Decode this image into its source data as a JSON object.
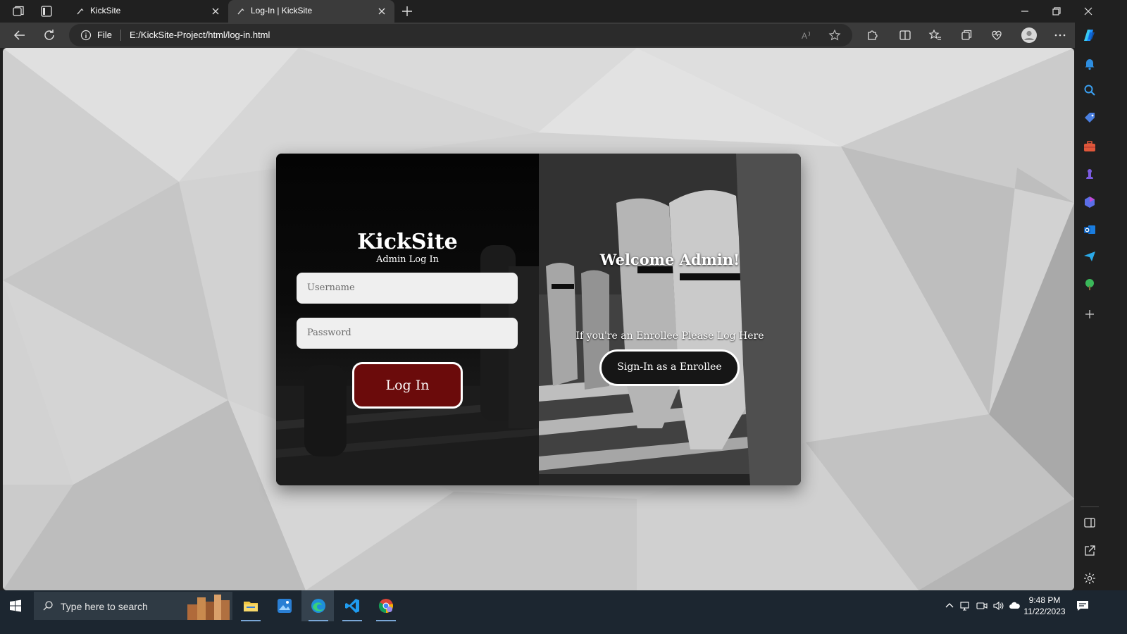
{
  "browser": {
    "tabs": [
      {
        "title": "KickSite",
        "active": false
      },
      {
        "title": "Log-In | KickSite",
        "active": true
      }
    ],
    "address": {
      "scheme": "File",
      "url": "E:/KickSite-Project/html/log-in.html"
    }
  },
  "page": {
    "login_panel": {
      "brand": "KickSite",
      "subtitle": "Admin Log In",
      "username_placeholder": "Username",
      "password_placeholder": "Password",
      "login_button": "Log In"
    },
    "enroll_panel": {
      "welcome": "Welcome Admin!",
      "prompt": "If you're an Enrollee Please Log Here",
      "signin_button": "Sign-In as a Enrollee"
    }
  },
  "taskbar": {
    "search_placeholder": "Type here to search",
    "time": "9:48 PM",
    "date": "11/22/2023"
  },
  "colors": {
    "login_button": "#6b0b0b",
    "page_background": "#d0d0d0",
    "card_background": "#050505"
  }
}
